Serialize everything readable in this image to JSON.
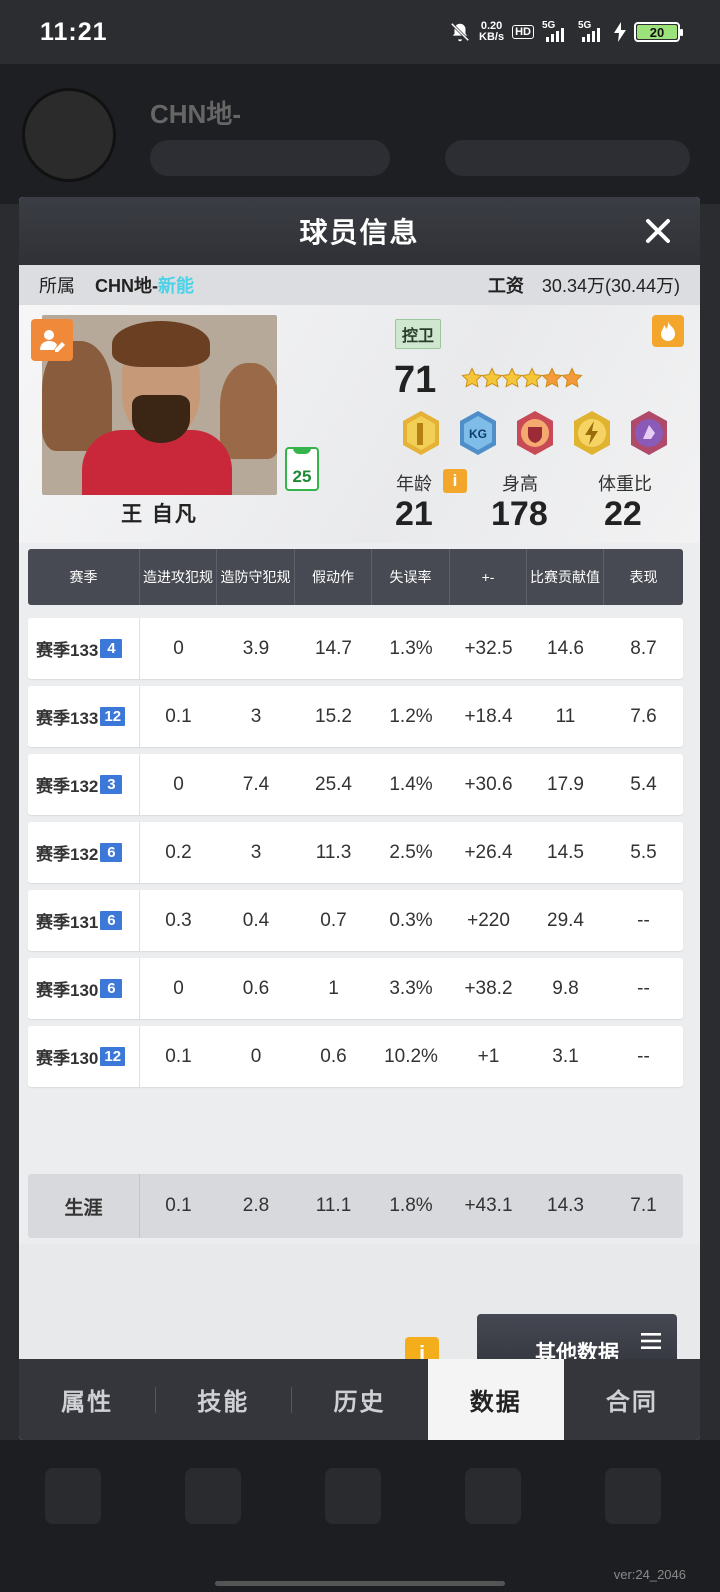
{
  "status_bar": {
    "time": "11:21",
    "net_speed_value": "0.20",
    "net_speed_unit": "KB/s",
    "hd_label": "HD",
    "sim1_label": "5G",
    "sim2_label": "5G",
    "battery": "20"
  },
  "background": {
    "team_name": "CHN地-",
    "version": "ver:24_2046"
  },
  "modal": {
    "title": "球员信息",
    "team_label": "所属",
    "team_name": "CHN地-",
    "team_suffix": "新能",
    "salary_label": "工资",
    "salary_value": "30.34万(30.44万)"
  },
  "player": {
    "name": "王 自凡",
    "jersey_number": "25",
    "position": "控卫",
    "rating": "71",
    "stars_total": 6,
    "age_label": "年龄",
    "age": "21",
    "height_label": "身高",
    "height": "178",
    "weight_label": "体重比",
    "weight": "22",
    "badges": [
      "hand-badge-icon",
      "kg-badge-icon",
      "shield-badge-icon",
      "lightning-badge-icon",
      "purple-badge-icon"
    ]
  },
  "table": {
    "headers": [
      "赛季",
      "造进攻犯规",
      "造防守犯规",
      "假动作",
      "失误率",
      "+-",
      "比赛贡献值",
      "表现"
    ],
    "rows": [
      {
        "season": "赛季133",
        "badge": "4",
        "values": [
          "0",
          "3.9",
          "14.7",
          "1.3%",
          "+32.5",
          "14.6",
          "8.7"
        ]
      },
      {
        "season": "赛季133",
        "badge": "12",
        "values": [
          "0.1",
          "3",
          "15.2",
          "1.2%",
          "+18.4",
          "11",
          "7.6"
        ]
      },
      {
        "season": "赛季132",
        "badge": "3",
        "values": [
          "0",
          "7.4",
          "25.4",
          "1.4%",
          "+30.6",
          "17.9",
          "5.4"
        ]
      },
      {
        "season": "赛季132",
        "badge": "6",
        "values": [
          "0.2",
          "3",
          "11.3",
          "2.5%",
          "+26.4",
          "14.5",
          "5.5"
        ]
      },
      {
        "season": "赛季131",
        "badge": "6",
        "values": [
          "0.3",
          "0.4",
          "0.7",
          "0.3%",
          "+220",
          "29.4",
          "--"
        ]
      },
      {
        "season": "赛季130",
        "badge": "6",
        "values": [
          "0",
          "0.6",
          "1",
          "3.3%",
          "+38.2",
          "9.8",
          "--"
        ]
      },
      {
        "season": "赛季130",
        "badge": "12",
        "values": [
          "0.1",
          "0",
          "0.6",
          "10.2%",
          "+1",
          "3.1",
          "--"
        ]
      }
    ],
    "career": {
      "label": "生涯",
      "values": [
        "0.1",
        "2.8",
        "11.1",
        "1.8%",
        "+43.1",
        "14.3",
        "7.1"
      ]
    }
  },
  "buttons": {
    "info_icon": "i",
    "other_data": "其他数据"
  },
  "tabs": [
    {
      "label": "属性",
      "active": false
    },
    {
      "label": "技能",
      "active": false
    },
    {
      "label": "历史",
      "active": false
    },
    {
      "label": "数据",
      "active": true
    },
    {
      "label": "合同",
      "active": false
    }
  ],
  "colors": {
    "accent_orange": "#f4ae1c",
    "season_badge_blue": "#3c78d8",
    "team_suffix_cyan": "#4cd2e8"
  }
}
